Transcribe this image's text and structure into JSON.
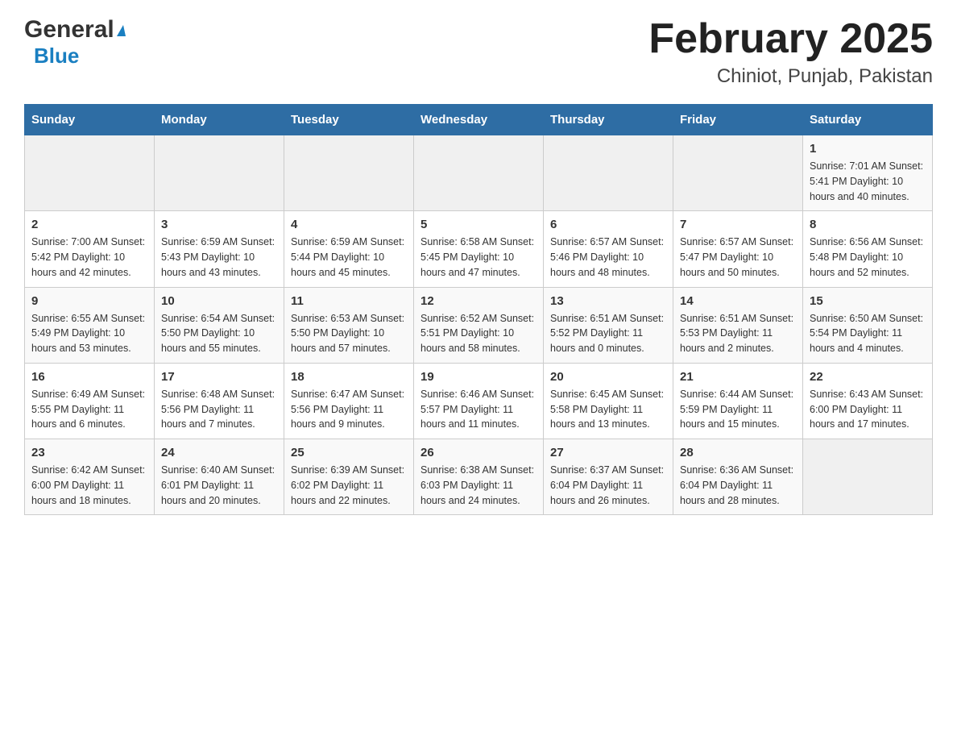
{
  "header": {
    "logo_general": "General",
    "logo_blue": "Blue",
    "title": "February 2025",
    "subtitle": "Chiniot, Punjab, Pakistan"
  },
  "weekdays": [
    "Sunday",
    "Monday",
    "Tuesday",
    "Wednesday",
    "Thursday",
    "Friday",
    "Saturday"
  ],
  "weeks": [
    [
      {
        "day": "",
        "info": ""
      },
      {
        "day": "",
        "info": ""
      },
      {
        "day": "",
        "info": ""
      },
      {
        "day": "",
        "info": ""
      },
      {
        "day": "",
        "info": ""
      },
      {
        "day": "",
        "info": ""
      },
      {
        "day": "1",
        "info": "Sunrise: 7:01 AM\nSunset: 5:41 PM\nDaylight: 10 hours\nand 40 minutes."
      }
    ],
    [
      {
        "day": "2",
        "info": "Sunrise: 7:00 AM\nSunset: 5:42 PM\nDaylight: 10 hours\nand 42 minutes."
      },
      {
        "day": "3",
        "info": "Sunrise: 6:59 AM\nSunset: 5:43 PM\nDaylight: 10 hours\nand 43 minutes."
      },
      {
        "day": "4",
        "info": "Sunrise: 6:59 AM\nSunset: 5:44 PM\nDaylight: 10 hours\nand 45 minutes."
      },
      {
        "day": "5",
        "info": "Sunrise: 6:58 AM\nSunset: 5:45 PM\nDaylight: 10 hours\nand 47 minutes."
      },
      {
        "day": "6",
        "info": "Sunrise: 6:57 AM\nSunset: 5:46 PM\nDaylight: 10 hours\nand 48 minutes."
      },
      {
        "day": "7",
        "info": "Sunrise: 6:57 AM\nSunset: 5:47 PM\nDaylight: 10 hours\nand 50 minutes."
      },
      {
        "day": "8",
        "info": "Sunrise: 6:56 AM\nSunset: 5:48 PM\nDaylight: 10 hours\nand 52 minutes."
      }
    ],
    [
      {
        "day": "9",
        "info": "Sunrise: 6:55 AM\nSunset: 5:49 PM\nDaylight: 10 hours\nand 53 minutes."
      },
      {
        "day": "10",
        "info": "Sunrise: 6:54 AM\nSunset: 5:50 PM\nDaylight: 10 hours\nand 55 minutes."
      },
      {
        "day": "11",
        "info": "Sunrise: 6:53 AM\nSunset: 5:50 PM\nDaylight: 10 hours\nand 57 minutes."
      },
      {
        "day": "12",
        "info": "Sunrise: 6:52 AM\nSunset: 5:51 PM\nDaylight: 10 hours\nand 58 minutes."
      },
      {
        "day": "13",
        "info": "Sunrise: 6:51 AM\nSunset: 5:52 PM\nDaylight: 11 hours\nand 0 minutes."
      },
      {
        "day": "14",
        "info": "Sunrise: 6:51 AM\nSunset: 5:53 PM\nDaylight: 11 hours\nand 2 minutes."
      },
      {
        "day": "15",
        "info": "Sunrise: 6:50 AM\nSunset: 5:54 PM\nDaylight: 11 hours\nand 4 minutes."
      }
    ],
    [
      {
        "day": "16",
        "info": "Sunrise: 6:49 AM\nSunset: 5:55 PM\nDaylight: 11 hours\nand 6 minutes."
      },
      {
        "day": "17",
        "info": "Sunrise: 6:48 AM\nSunset: 5:56 PM\nDaylight: 11 hours\nand 7 minutes."
      },
      {
        "day": "18",
        "info": "Sunrise: 6:47 AM\nSunset: 5:56 PM\nDaylight: 11 hours\nand 9 minutes."
      },
      {
        "day": "19",
        "info": "Sunrise: 6:46 AM\nSunset: 5:57 PM\nDaylight: 11 hours\nand 11 minutes."
      },
      {
        "day": "20",
        "info": "Sunrise: 6:45 AM\nSunset: 5:58 PM\nDaylight: 11 hours\nand 13 minutes."
      },
      {
        "day": "21",
        "info": "Sunrise: 6:44 AM\nSunset: 5:59 PM\nDaylight: 11 hours\nand 15 minutes."
      },
      {
        "day": "22",
        "info": "Sunrise: 6:43 AM\nSunset: 6:00 PM\nDaylight: 11 hours\nand 17 minutes."
      }
    ],
    [
      {
        "day": "23",
        "info": "Sunrise: 6:42 AM\nSunset: 6:00 PM\nDaylight: 11 hours\nand 18 minutes."
      },
      {
        "day": "24",
        "info": "Sunrise: 6:40 AM\nSunset: 6:01 PM\nDaylight: 11 hours\nand 20 minutes."
      },
      {
        "day": "25",
        "info": "Sunrise: 6:39 AM\nSunset: 6:02 PM\nDaylight: 11 hours\nand 22 minutes."
      },
      {
        "day": "26",
        "info": "Sunrise: 6:38 AM\nSunset: 6:03 PM\nDaylight: 11 hours\nand 24 minutes."
      },
      {
        "day": "27",
        "info": "Sunrise: 6:37 AM\nSunset: 6:04 PM\nDaylight: 11 hours\nand 26 minutes."
      },
      {
        "day": "28",
        "info": "Sunrise: 6:36 AM\nSunset: 6:04 PM\nDaylight: 11 hours\nand 28 minutes."
      },
      {
        "day": "",
        "info": ""
      }
    ]
  ]
}
